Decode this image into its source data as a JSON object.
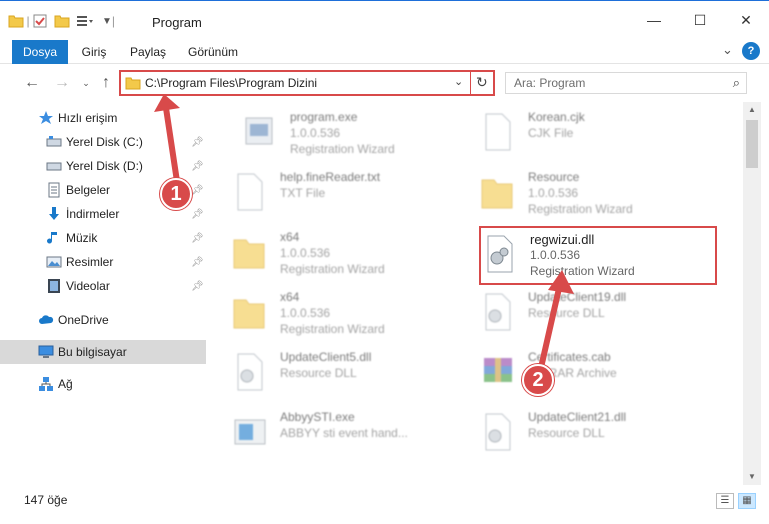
{
  "window": {
    "title": "Program",
    "controls": {
      "minimize": "—",
      "maximize": "☐",
      "close": "✕"
    }
  },
  "ribbon": {
    "tabs": [
      {
        "label": "Dosya"
      },
      {
        "label": "Giriş"
      },
      {
        "label": "Paylaş"
      },
      {
        "label": "Görünüm"
      }
    ],
    "help": "?"
  },
  "nav": {
    "address": "C:\\Program Files\\Program Dizini",
    "search_placeholder": "Ara: Program"
  },
  "sidebar": {
    "items": [
      {
        "label": "Hızlı erişim",
        "icon": "star-icon"
      },
      {
        "label": "Yerel Disk (C:)",
        "icon": "drive-icon"
      },
      {
        "label": "Yerel Disk (D:)",
        "icon": "drive-icon"
      },
      {
        "label": "Belgeler",
        "icon": "documents-icon"
      },
      {
        "label": "İndirmeler",
        "icon": "download-icon"
      },
      {
        "label": "Müzik",
        "icon": "music-icon"
      },
      {
        "label": "Resimler",
        "icon": "pictures-icon"
      },
      {
        "label": "Videolar",
        "icon": "video-icon"
      },
      {
        "label": "OneDrive",
        "icon": "cloud-icon"
      },
      {
        "label": "Bu bilgisayar",
        "icon": "computer-icon"
      },
      {
        "label": "Ağ",
        "icon": "network-icon"
      }
    ]
  },
  "files": [
    {
      "name": "program.exe",
      "line1": "1.0.0.536",
      "line2": "Registration Wizard",
      "icon": "exe-icon"
    },
    {
      "name": "Korean.cjk",
      "line1": "CJK File",
      "line2": "",
      "icon": "file-icon"
    },
    {
      "name": "help.fineReader.txt",
      "line1": "TXT File",
      "line2": "",
      "icon": "file-icon"
    },
    {
      "name": "Resource",
      "line1": "1.0.0.536",
      "line2": "Registration Wizard",
      "icon": "folder-icon"
    },
    {
      "name": "x64",
      "line1": "1.0.0.536",
      "line2": "Registration Wizard",
      "icon": "folder-icon"
    },
    {
      "name": "regwizui.dll",
      "line1": "1.0.0.536",
      "line2": "Registration Wizard",
      "icon": "dll-icon"
    },
    {
      "name": "x64",
      "line1": "1.0.0.536",
      "line2": "Registration Wizard",
      "icon": "folder-icon"
    },
    {
      "name": "UpdateClient19.dll",
      "line1": "Resource DLL",
      "line2": "",
      "icon": "dll-icon"
    },
    {
      "name": "UpdateClient5.dll",
      "line1": "Resource DLL",
      "line2": "",
      "icon": "dll-icon"
    },
    {
      "name": "Certificates.cab",
      "line1": "WinRAR Archive",
      "line2": "",
      "icon": "archive-icon"
    },
    {
      "name": "AbbyySTI.exe",
      "line1": "ABBYY sti event hand...",
      "line2": "",
      "icon": "exe-icon"
    },
    {
      "name": "UpdateClient21.dll",
      "line1": "Resource DLL",
      "line2": "",
      "icon": "dll-icon"
    }
  ],
  "status": {
    "count": "147 öğe"
  },
  "annotations": {
    "step1": "1",
    "step2": "2"
  },
  "colors": {
    "accent": "#1979ca",
    "highlight": "#d84a4a"
  }
}
